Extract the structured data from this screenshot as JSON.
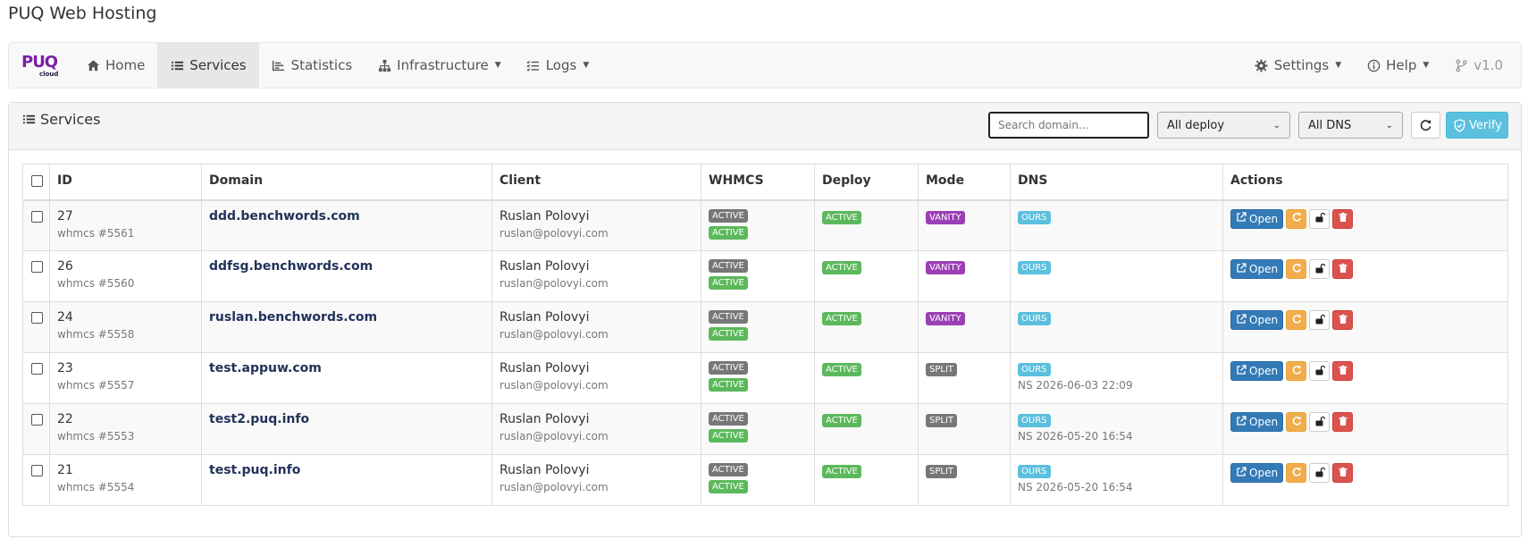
{
  "page_title": "PUQ Web Hosting",
  "brand": {
    "main": "PUQ",
    "sub": "cloud"
  },
  "nav": {
    "home": "Home",
    "services": "Services",
    "statistics": "Statistics",
    "infrastructure": "Infrastructure",
    "logs": "Logs",
    "settings": "Settings",
    "help": "Help",
    "version": "v1.0"
  },
  "panel": {
    "title": "Services",
    "search_placeholder": "Search domain...",
    "deploy_filter": "All deploy",
    "dns_filter": "All DNS",
    "verify_label": "Verify"
  },
  "table": {
    "headers": {
      "id": "ID",
      "domain": "Domain",
      "client": "Client",
      "whmcs": "WHMCS",
      "deploy": "Deploy",
      "mode": "Mode",
      "dns": "DNS",
      "actions": "Actions"
    },
    "open_label": "Open",
    "rows": [
      {
        "id": "27",
        "whmcs_ref": "whmcs #5561",
        "domain": "ddd.benchwords.com",
        "client_name": "Ruslan Polovyi",
        "client_email": "ruslan@polovyi.com",
        "whmcs1": "ACTIVE",
        "whmcs2": "ACTIVE",
        "deploy": "ACTIVE",
        "mode": "VANITY",
        "dns": "OURS",
        "ns": ""
      },
      {
        "id": "26",
        "whmcs_ref": "whmcs #5560",
        "domain": "ddfsg.benchwords.com",
        "client_name": "Ruslan Polovyi",
        "client_email": "ruslan@polovyi.com",
        "whmcs1": "ACTIVE",
        "whmcs2": "ACTIVE",
        "deploy": "ACTIVE",
        "mode": "VANITY",
        "dns": "OURS",
        "ns": ""
      },
      {
        "id": "24",
        "whmcs_ref": "whmcs #5558",
        "domain": "ruslan.benchwords.com",
        "client_name": "Ruslan Polovyi",
        "client_email": "ruslan@polovyi.com",
        "whmcs1": "ACTIVE",
        "whmcs2": "ACTIVE",
        "deploy": "ACTIVE",
        "mode": "VANITY",
        "dns": "OURS",
        "ns": ""
      },
      {
        "id": "23",
        "whmcs_ref": "whmcs #5557",
        "domain": "test.appuw.com",
        "client_name": "Ruslan Polovyi",
        "client_email": "ruslan@polovyi.com",
        "whmcs1": "ACTIVE",
        "whmcs2": "ACTIVE",
        "deploy": "ACTIVE",
        "mode": "SPLIT",
        "dns": "OURS",
        "ns": "NS 2026-06-03 22:09"
      },
      {
        "id": "22",
        "whmcs_ref": "whmcs #5553",
        "domain": "test2.puq.info",
        "client_name": "Ruslan Polovyi",
        "client_email": "ruslan@polovyi.com",
        "whmcs1": "ACTIVE",
        "whmcs2": "ACTIVE",
        "deploy": "ACTIVE",
        "mode": "SPLIT",
        "dns": "OURS",
        "ns": "NS 2026-05-20 16:54"
      },
      {
        "id": "21",
        "whmcs_ref": "whmcs #5554",
        "domain": "test.puq.info",
        "client_name": "Ruslan Polovyi",
        "client_email": "ruslan@polovyi.com",
        "whmcs1": "ACTIVE",
        "whmcs2": "ACTIVE",
        "deploy": "ACTIVE",
        "mode": "SPLIT",
        "dns": "OURS",
        "ns": "NS 2026-05-20 16:54"
      }
    ]
  },
  "colors": {
    "accent": "#337ab7",
    "active": "#5cb85c",
    "vanity": "#9b3fb5",
    "info": "#5bc0de",
    "danger": "#d9534f",
    "warning": "#f0ad4e"
  },
  "icons": [
    "home-icon",
    "list-icon",
    "bar-chart-icon",
    "sitemap-icon",
    "checklist-icon",
    "gear-icon",
    "info-circle-icon",
    "branch-icon",
    "refresh-icon",
    "shield-check-icon",
    "external-link-icon",
    "sync-icon",
    "unlock-icon",
    "trash-icon"
  ]
}
